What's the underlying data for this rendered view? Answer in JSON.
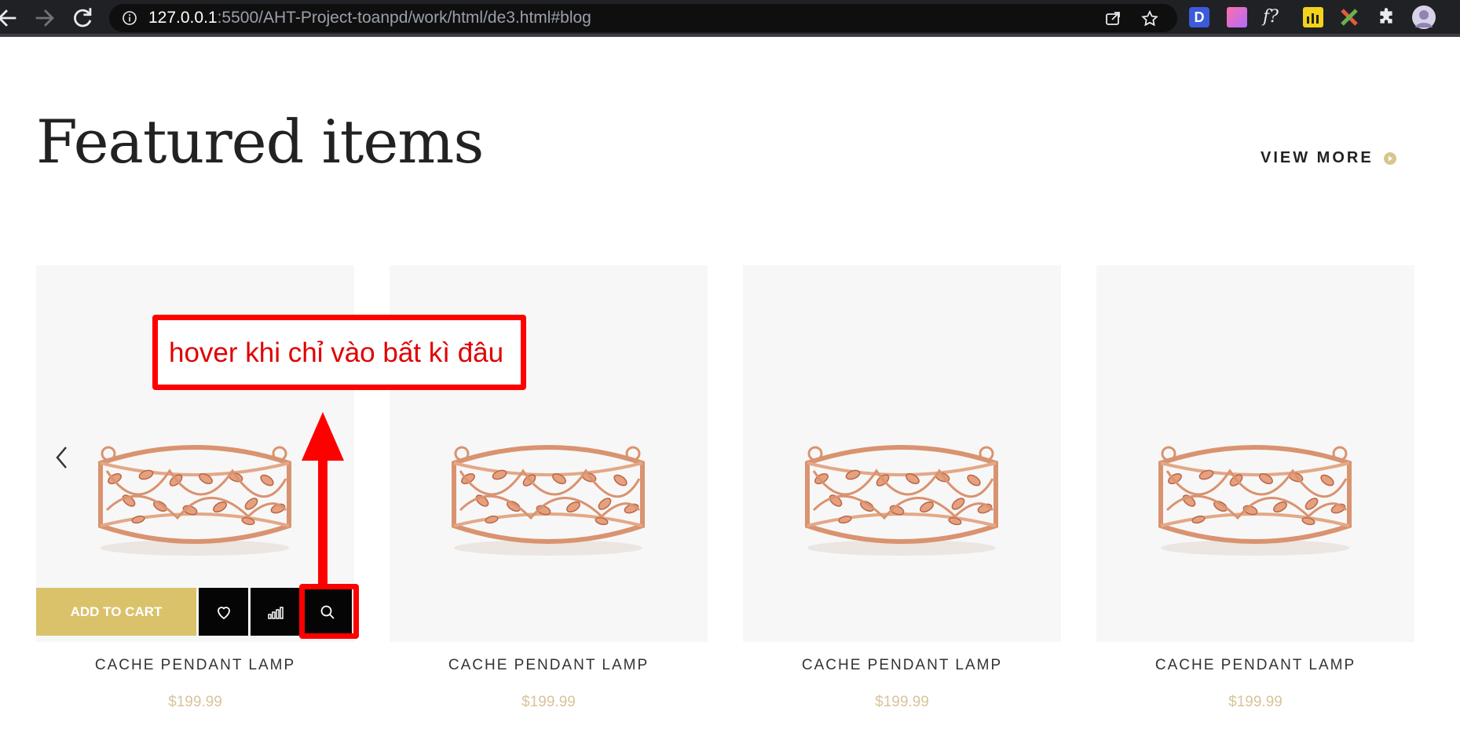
{
  "browser": {
    "url_host": "127.0.0.1",
    "url_rest": ":5500/AHT-Project-toanpd/work/html/de3.html#blog",
    "extensions": [
      "d-extension-icon",
      "gradient-extension-icon",
      "fx-extension-icon",
      "chart-extension-icon",
      "cross-extension-icon",
      "puzzle-icon",
      "profile-avatar"
    ],
    "ext_fx_label": "f?",
    "ext_d_label": "D"
  },
  "section": {
    "title": "Featured items",
    "view_more": "VIEW MORE"
  },
  "products": [
    {
      "name": "CACHE PENDANT LAMP",
      "price": "$199.99"
    },
    {
      "name": "CACHE PENDANT LAMP",
      "price": "$199.99"
    },
    {
      "name": "CACHE PENDANT LAMP",
      "price": "$199.99"
    },
    {
      "name": "CACHE PENDANT LAMP",
      "price": "$199.99"
    }
  ],
  "actions": {
    "add_to_cart": "ADD TO CART"
  },
  "annotation": {
    "text": "hover khi chỉ vào bất kì đâu"
  },
  "colors": {
    "accent_gold": "#d9c26a",
    "price": "#d8c49a",
    "annotation_red": "#ff0000"
  }
}
